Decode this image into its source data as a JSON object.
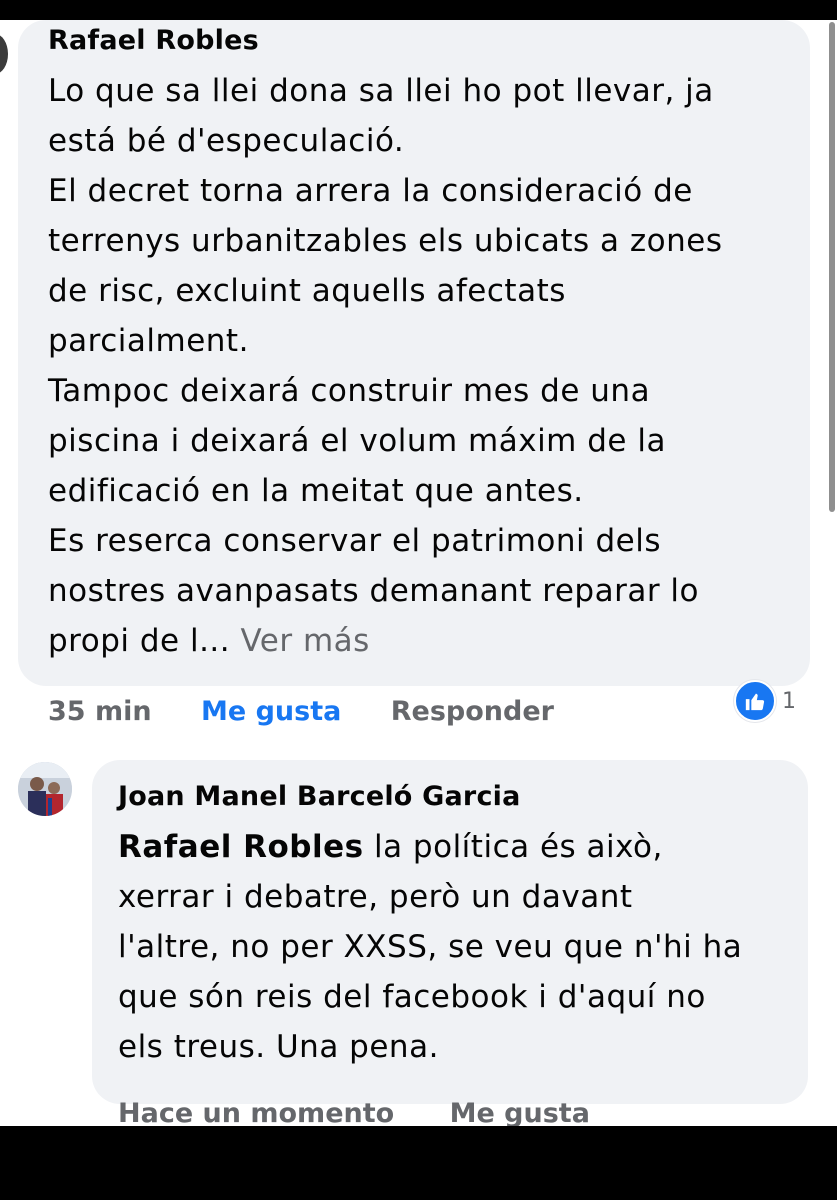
{
  "comments": [
    {
      "author": "Rafael Robles",
      "lines": [
        "Lo que sa llei dona sa llei ho pot llevar, ja",
        "está bé d'especulació.",
        "El decret torna arrera la consideració de",
        "terrenys urbanitzables els ubicats a zones",
        "de risc, excluint aquells afectats",
        "parcialment.",
        "Tampoc deixará construir mes de una",
        "piscina i deixará el volum máxim de la",
        "edificació en la meitat que antes.",
        "Es reserca conservar el patrimoni dels",
        "nostres avanpasats demanant reparar lo"
      ],
      "last_line": "propi de l...",
      "see_more": "Ver más",
      "time": "35 min",
      "like_label": "Me gusta",
      "reply_label": "Responder",
      "reaction_count": "1",
      "reaction_icon": "thumbs-up-icon"
    },
    {
      "author": "Joan Manel Barceló Garcia",
      "mention": "Rafael Robles",
      "first_line_rest": " la política és això,",
      "lines": [
        "xerrar i debatre, però un davant",
        "l'altre, no per XXSS, se veu que n'hi ha",
        "que són reis del facebook i d'aquí no",
        "els treus. Una pena."
      ],
      "time": "Hace un momento",
      "like_label": "Me gusta"
    }
  ],
  "colors": {
    "bubble": "#f0f2f5",
    "link": "#1877f2",
    "secondary_text": "#65676b"
  }
}
